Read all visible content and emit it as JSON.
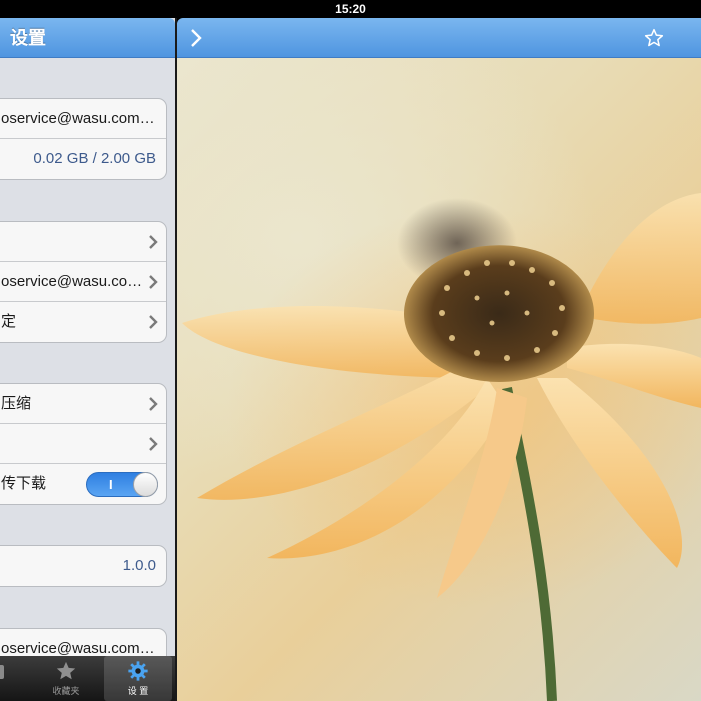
{
  "status_bar": {
    "time": "15:20"
  },
  "settings": {
    "nav_title": "设置",
    "account_group": [
      {
        "text": "oservice@wasu.com.cn"
      },
      {
        "text": "",
        "value": "0.02 GB / 2.00 GB"
      }
    ],
    "share_group": [
      {
        "text": ""
      },
      {
        "text": "oservice@wasu.com.cn"
      },
      {
        "text": "定"
      }
    ],
    "upload_group": [
      {
        "text": "压缩"
      },
      {
        "text": ""
      },
      {
        "text": "传下载",
        "toggle_label": "I",
        "toggle_on": true
      }
    ],
    "version_group": {
      "value": "1.0.0"
    },
    "contact_group": {
      "text": "oservice@wasu.com.cn"
    }
  },
  "tab_bar": {
    "items": [
      {
        "label": "",
        "icon": "partial-icon"
      },
      {
        "label": "收藏夹",
        "icon": "star-icon"
      },
      {
        "label": "设 置",
        "icon": "gear-icon",
        "active": true
      }
    ]
  },
  "viewer": {
    "back_icon": "chevron-right-icon",
    "favorite_icon": "star-outline-icon"
  },
  "colors": {
    "nav_blue": "#5a9fe6",
    "toggle_blue": "#3b8ae6",
    "background": "#dde0e6"
  }
}
